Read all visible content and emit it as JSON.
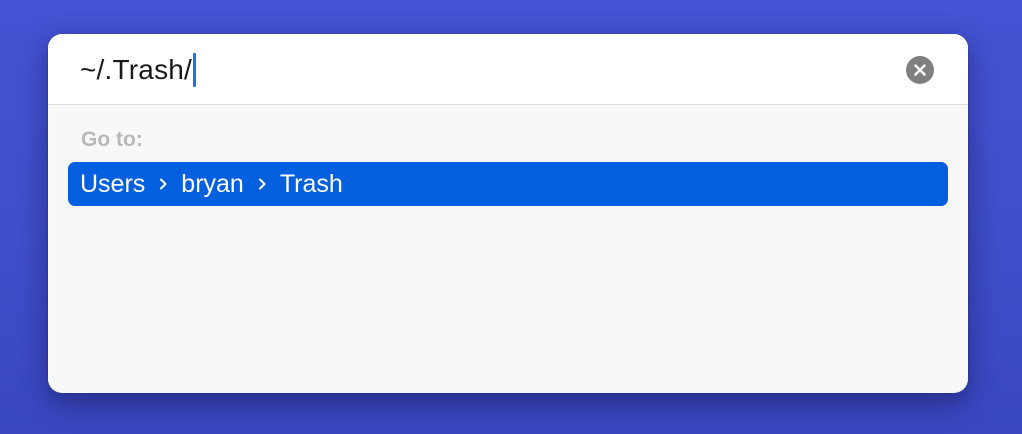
{
  "go_to_folder": {
    "path_value": "~/.Trash/",
    "clear_icon": "xmark-circle-fill-icon",
    "suggestions_label": "Go to:",
    "results": [
      {
        "segments": [
          "Users",
          "bryan",
          "Trash"
        ],
        "separator_icon": "chevron-right-icon",
        "selected": true
      }
    ]
  },
  "colors": {
    "background": "#4250d0",
    "selection": "#0560e0",
    "caret": "#1a73e8",
    "clear_button": "#808080"
  }
}
